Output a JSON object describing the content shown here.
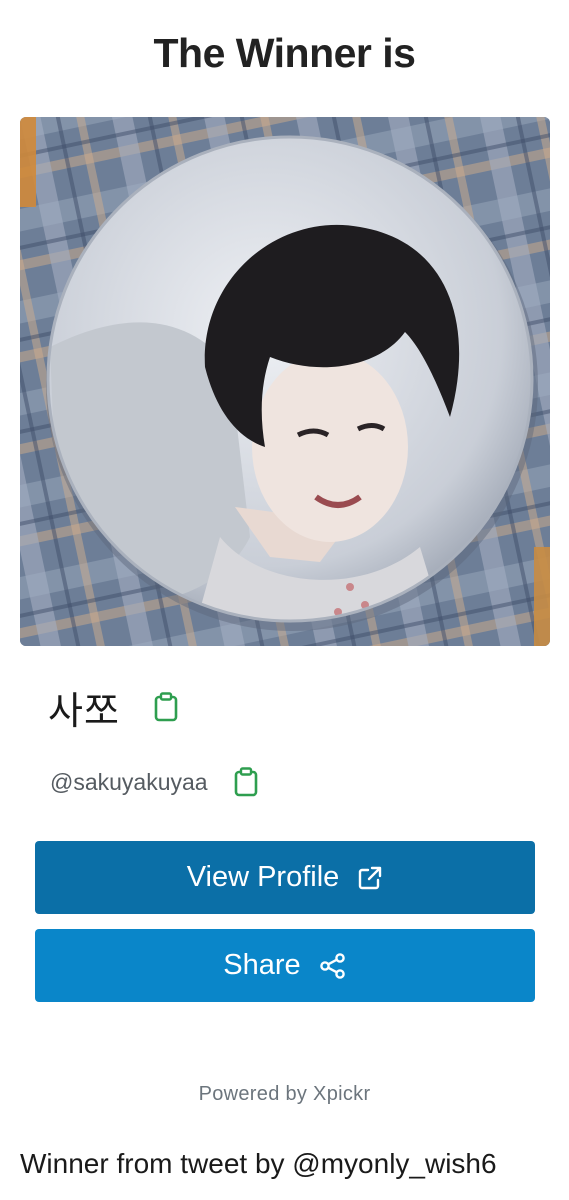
{
  "header": {
    "title": "The Winner is"
  },
  "winner": {
    "display_name": "사쪼",
    "handle": "@sakuyakuyaa",
    "photo_alt": "Winner profile photo"
  },
  "actions": {
    "view_profile_label": "View Profile",
    "share_label": "Share"
  },
  "footer": {
    "powered_by": "Powered by Xpickr",
    "source": "Winner from tweet by @myonly_wish6"
  },
  "icons": {
    "copy": "clipboard-icon",
    "external": "external-link-icon",
    "share": "share-icon"
  },
  "colors": {
    "view_button": "#0b6fa7",
    "share_button": "#0a86c9",
    "copy_icon": "#2e9e4f"
  }
}
